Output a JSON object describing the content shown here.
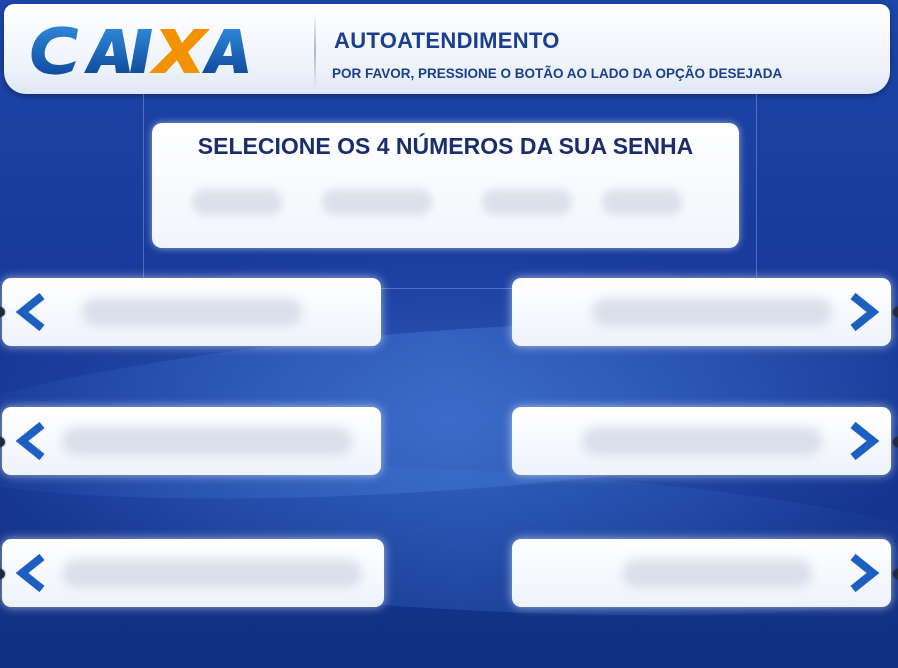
{
  "header": {
    "logo_text": "CAIXA",
    "title": "AUTOATENDIMENTO",
    "subtitle": "POR FAVOR, PRESSIONE O BOTÃO AO LADO DA OPÇÃO DESEJADA"
  },
  "prompt": {
    "text": "SELECIONE OS 4 NÚMEROS DA SUA SENHA"
  },
  "buttons": {
    "left": [
      {
        "icon": "chevron-left-icon"
      },
      {
        "icon": "chevron-left-icon"
      },
      {
        "icon": "chevron-left-icon"
      }
    ],
    "right": [
      {
        "icon": "chevron-right-icon"
      },
      {
        "icon": "chevron-right-icon"
      },
      {
        "icon": "chevron-right-icon"
      }
    ]
  },
  "colors": {
    "brand_blue": "#1a5fb4",
    "brand_orange": "#f39200",
    "arrow_blue": "#1d5fc0",
    "text_dark_blue": "#1a3f8f"
  }
}
